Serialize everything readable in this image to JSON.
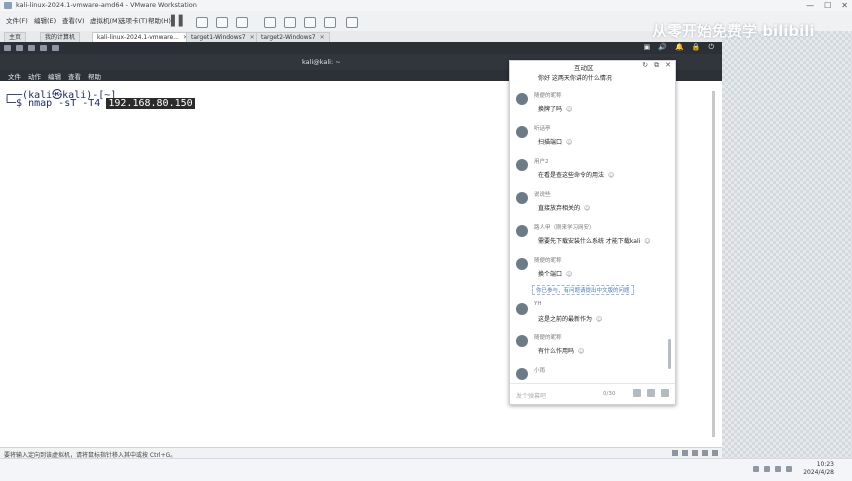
{
  "window": {
    "title": "kali-linux-2024.1-vmware-amd64 - VMware Workstation"
  },
  "window_controls": [
    "—",
    "☐",
    "✕"
  ],
  "vm_menu": [
    {
      "label": "文件(F)"
    },
    {
      "label": "编辑(E)"
    },
    {
      "label": "查看(V)"
    },
    {
      "label": "虚拟机(M)"
    },
    {
      "label": "选项卡(T)"
    },
    {
      "label": "帮助(H)"
    }
  ],
  "tabs": [
    {
      "label": "主页",
      "active": false
    },
    {
      "label": "我的计算机",
      "active": false
    },
    {
      "label": "kali-linux-2024.1-vmware...",
      "active": true
    },
    {
      "label": "target1-Windows7",
      "active": false
    },
    {
      "label": "target2-Windows7",
      "active": false
    }
  ],
  "terminal": {
    "title": "kali@kali: ~",
    "menu": [
      "文件",
      "动作",
      "编辑",
      "查看",
      "帮助"
    ],
    "prompt_line": "┌──(kali㉿kali)-[~]",
    "command_prefix": "└─$ nmap -sT -T4 ",
    "command_ip": "192.168.80.150"
  },
  "kali_tray": [
    "▣",
    "🔊",
    "🔔",
    "🔒",
    "⏻"
  ],
  "statusbar": {
    "text": "要将输入定向到该虚拟机，请将鼠标指针移入其中或按 Ctrl+G。"
  },
  "watermark": "从零开始免费学 bilibili",
  "chat": {
    "title": "互动区",
    "header_icons": [
      "↻",
      "⧉",
      "✕"
    ],
    "top_message": "你好 这两天你讲的什么情况",
    "messages": [
      {
        "name": "随便的昵称",
        "text": "换牌了吗"
      },
      {
        "name": "听话亭",
        "text": "扫描端口"
      },
      {
        "name": "用户2",
        "text": "在看是查这些命令的用法"
      },
      {
        "name": "说说些",
        "text": "直接放弃相关的"
      },
      {
        "name": "路人甲（刚来学习网安）",
        "text": "需要先下载安装什么系统 才能下载kali"
      },
      {
        "name": "随便的昵称",
        "text": "换个端口"
      },
      {
        "name": "YH",
        "text": "这是之前的最新作为"
      },
      {
        "name": "随便的昵称",
        "text": "有什么作用吗"
      },
      {
        "name": "小雨",
        "text": ""
      }
    ],
    "notice": "你已参与，有问题请提出中文版的问题",
    "input_placeholder": "发个弹幕吧",
    "char_count": "0/30",
    "footer_icons": [
      "image-icon",
      "emoji-icon",
      "gift-icon"
    ]
  },
  "taskbar": {
    "time": "10:23",
    "date": "2024/4/28"
  }
}
